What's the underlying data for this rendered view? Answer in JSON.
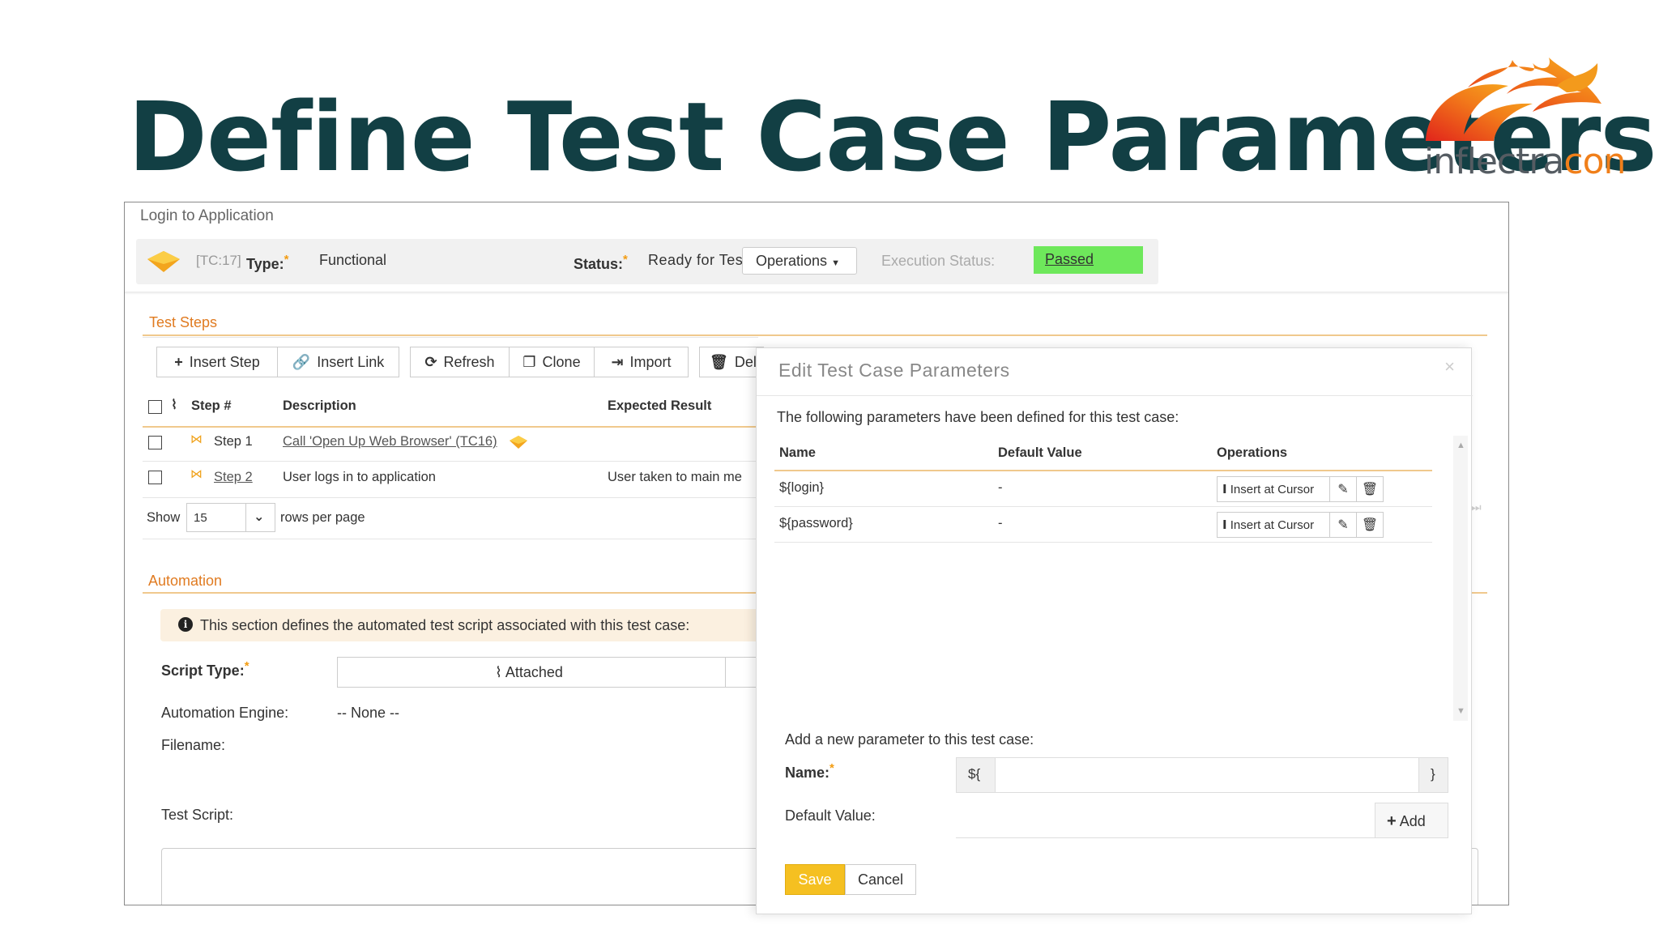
{
  "slide": {
    "title": "Define Test Case Parameters",
    "logo_part1": "inflectra",
    "logo_part2": "con"
  },
  "app": {
    "breadcrumb": "Login to Application",
    "header": {
      "test_case_id": "[TC:17]",
      "type_label": "Type:",
      "type_value": "Functional",
      "status_label": "Status:",
      "status_value": "Ready for Test",
      "operations_label": "Operations",
      "execution_status_label": "Execution Status:",
      "execution_status_value": "Passed",
      "required_mark": "*"
    },
    "test_steps": {
      "section_title": "Test Steps",
      "toolbar": {
        "insert_step": "Insert Step",
        "insert_link": "Insert Link",
        "refresh": "Refresh",
        "clone": "Clone",
        "import": "Import",
        "delete": "Del"
      },
      "columns": {
        "step": "Step #",
        "description": "Description",
        "expected": "Expected Result"
      },
      "rows": [
        {
          "step": "Step 1",
          "description": "Call 'Open Up Web Browser' (TC16)",
          "expected": ""
        },
        {
          "step": "Step 2",
          "description": "User logs in to application",
          "expected": "User taken to main me"
        }
      ],
      "show_label": "Show",
      "page_size": "15",
      "rows_per_page": "rows per page"
    },
    "automation": {
      "section_title": "Automation",
      "notice": "This section defines the automated test script associated with this test case:",
      "script_type_label": "Script Type:",
      "script_type_value": "Attached",
      "engine_label": "Automation Engine:",
      "engine_value": "-- None --",
      "filename_label": "Filename:",
      "test_script_label": "Test Script:"
    }
  },
  "modal": {
    "title": "Edit Test Case Parameters",
    "close": "×",
    "intro": "The following parameters have been defined for this test case:",
    "columns": {
      "name": "Name",
      "default_value": "Default Value",
      "operations": "Operations"
    },
    "parameters": [
      {
        "name": "${login}",
        "default_value": "-",
        "insert_label": "Insert at Cursor"
      },
      {
        "name": "${password}",
        "default_value": "-",
        "insert_label": "Insert at Cursor"
      }
    ],
    "add_label": "Add a new parameter to this test case:",
    "name_label": "Name:",
    "name_prefix": "${",
    "name_suffix": "}",
    "default_value_label": "Default Value:",
    "add_button": "Add",
    "save_button": "Save",
    "cancel_button": "Cancel",
    "required_mark": "*"
  },
  "colors": {
    "title": "#123f44",
    "accent_orange": "#e07b21",
    "passed_green": "#6ee85b",
    "save_yellow": "#f5c021"
  }
}
